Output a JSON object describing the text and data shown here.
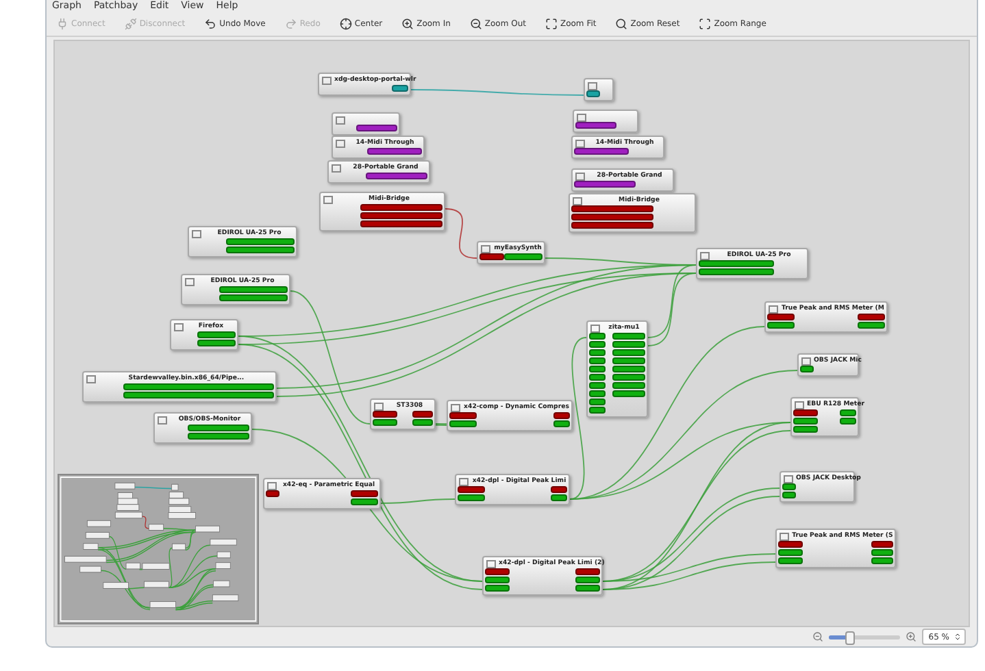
{
  "menu": [
    {
      "label": "Graph"
    },
    {
      "label": "Patchbay"
    },
    {
      "label": "Edit"
    },
    {
      "label": "View"
    },
    {
      "label": "Help"
    }
  ],
  "toolbar": [
    {
      "kind": "connect",
      "label": "Connect",
      "disabled": true
    },
    {
      "kind": "disconnect",
      "label": "Disconnect",
      "disabled": true
    },
    {
      "kind": "undo",
      "label": "Undo Move",
      "disabled": false
    },
    {
      "kind": "redo",
      "label": "Redo",
      "disabled": true
    },
    {
      "kind": "center",
      "label": "Center",
      "disabled": false
    },
    {
      "kind": "zoom-in",
      "label": "Zoom In",
      "disabled": false
    },
    {
      "kind": "zoom-out",
      "label": "Zoom Out",
      "disabled": false
    },
    {
      "kind": "zoom-fit",
      "label": "Zoom Fit",
      "disabled": false
    },
    {
      "kind": "zoom-reset",
      "label": "Zoom Reset",
      "disabled": false
    },
    {
      "kind": "zoom-range",
      "label": "Zoom Range",
      "disabled": false
    }
  ],
  "canvas": {
    "nodes": [
      {
        "title": "xdg-desktop-portal-wlr",
        "outs": [
          {
            "color": "#1aa3a3"
          }
        ]
      },
      {
        "ins": [
          {
            "color": "#1aa3a3"
          }
        ]
      },
      {
        "outs": [
          {
            "color": "#a020c0"
          }
        ]
      },
      {
        "ins": [
          {
            "color": "#a020c0"
          }
        ]
      },
      {
        "title": "14-Midi Through",
        "outs": [
          {
            "color": "#a020c0"
          }
        ]
      },
      {
        "title": "14-Midi Through",
        "ins": [
          {
            "color": "#a020c0"
          }
        ]
      },
      {
        "title": "28-Portable Grand",
        "outs": [
          {
            "color": "#a020c0"
          }
        ]
      },
      {
        "title": "28-Portable Grand",
        "ins": [
          {
            "color": "#a020c0"
          }
        ]
      },
      {
        "title": "Midi-Bridge",
        "outs": [
          {
            "color": "#b00000"
          },
          {
            "color": "#b00000"
          },
          {
            "color": "#b00000"
          }
        ]
      },
      {
        "title": "Midi-Bridge",
        "ins": [
          {
            "color": "#b00000"
          },
          {
            "color": "#b00000"
          },
          {
            "color": "#b00000"
          }
        ]
      },
      {
        "title": "EDIROL UA-25 Pro",
        "outs": [
          {
            "color": "#10b010"
          },
          {
            "color": "#10b010"
          }
        ]
      },
      {
        "title": "myEasySynth",
        "ins": [
          {
            "color": "#b00000"
          }
        ],
        "outs": [
          {
            "color": "#10b010"
          }
        ]
      },
      {
        "title": "EDIROL UA-25 Pro",
        "ins": [
          {
            "color": "#10b010"
          },
          {
            "color": "#10b010"
          }
        ]
      },
      {
        "title": "EDIROL UA-25 Pro",
        "outs": [
          {
            "color": "#10b010"
          },
          {
            "color": "#10b010"
          }
        ]
      },
      {
        "title": "Firefox",
        "outs": [
          {
            "color": "#10b010"
          },
          {
            "color": "#10b010"
          }
        ]
      },
      {
        "title": "zita-mu1",
        "ins": [
          {
            "color": "#10b010"
          },
          {
            "color": "#10b010"
          },
          {
            "color": "#10b010"
          },
          {
            "color": "#10b010"
          },
          {
            "color": "#10b010"
          },
          {
            "color": "#10b010"
          },
          {
            "color": "#10b010"
          },
          {
            "color": "#10b010"
          },
          {
            "color": "#10b010"
          },
          {
            "color": "#10b010"
          }
        ],
        "outs": [
          {
            "color": "#10b010"
          },
          {
            "color": "#10b010"
          },
          {
            "color": "#10b010"
          },
          {
            "color": "#10b010"
          },
          {
            "color": "#10b010"
          },
          {
            "color": "#10b010"
          },
          {
            "color": "#10b010"
          },
          {
            "color": "#10b010"
          }
        ]
      },
      {
        "title": "True Peak and RMS Meter (M",
        "ins": [
          {
            "color": "#b00000"
          },
          {
            "color": "#10b010"
          }
        ],
        "outs": [
          {
            "color": "#b00000"
          },
          {
            "color": "#10b010"
          }
        ]
      },
      {
        "title": "Stardewvalley.bin.x86_64/Pipe...",
        "outs": [
          {
            "color": "#10b010"
          },
          {
            "color": "#10b010"
          }
        ]
      },
      {
        "title": "OBS JACK Mic",
        "ins": [
          {
            "color": "#10b010"
          }
        ]
      },
      {
        "title": "EBU R128 Meter",
        "ins": [
          {
            "color": "#b00000"
          },
          {
            "color": "#10b010"
          },
          {
            "color": "#10b010"
          }
        ],
        "outs": [
          {
            "color": "#10b010"
          },
          {
            "color": "#10b010"
          }
        ]
      },
      {
        "title": "OBS/OBS-Monitor",
        "outs": [
          {
            "color": "#10b010"
          },
          {
            "color": "#10b010"
          }
        ]
      },
      {
        "title": "ST3308",
        "ins": [
          {
            "color": "#b00000"
          },
          {
            "color": "#10b010"
          }
        ],
        "outs": [
          {
            "color": "#b00000"
          },
          {
            "color": "#10b010"
          }
        ]
      },
      {
        "title": "x42-comp - Dynamic Compres",
        "ins": [
          {
            "color": "#b00000"
          },
          {
            "color": "#10b010"
          }
        ],
        "outs": [
          {
            "color": "#b00000"
          },
          {
            "color": "#10b010"
          }
        ]
      },
      {
        "title": "x42-eq - Parametric Equal",
        "ins": [
          {
            "color": "#b00000"
          }
        ],
        "outs": [
          {
            "color": "#b00000"
          },
          {
            "color": "#10b010"
          }
        ]
      },
      {
        "title": "x42-dpl - Digital Peak Limi",
        "ins": [
          {
            "color": "#b00000"
          },
          {
            "color": "#10b010"
          }
        ],
        "outs": [
          {
            "color": "#b00000"
          },
          {
            "color": "#10b010"
          }
        ]
      },
      {
        "title": "OBS JACK Desktop",
        "ins": [
          {
            "color": "#10b010"
          },
          {
            "color": "#10b010"
          }
        ]
      },
      {
        "title": "x42-dpl - Digital Peak Limi (2)",
        "ins": [
          {
            "color": "#b00000"
          },
          {
            "color": "#10b010"
          },
          {
            "color": "#10b010"
          }
        ],
        "outs": [
          {
            "color": "#b00000"
          },
          {
            "color": "#10b010"
          },
          {
            "color": "#10b010"
          }
        ]
      },
      {
        "title": "True Peak and RMS Meter (S",
        "ins": [
          {
            "color": "#b00000"
          },
          {
            "color": "#10b010"
          },
          {
            "color": "#10b010"
          }
        ],
        "outs": [
          {
            "color": "#b00000"
          },
          {
            "color": "#10b010"
          },
          {
            "color": "#10b010"
          }
        ]
      }
    ]
  },
  "status": {
    "zoom_slider": {
      "level": 0.3
    },
    "zoom_value": "65 %"
  }
}
